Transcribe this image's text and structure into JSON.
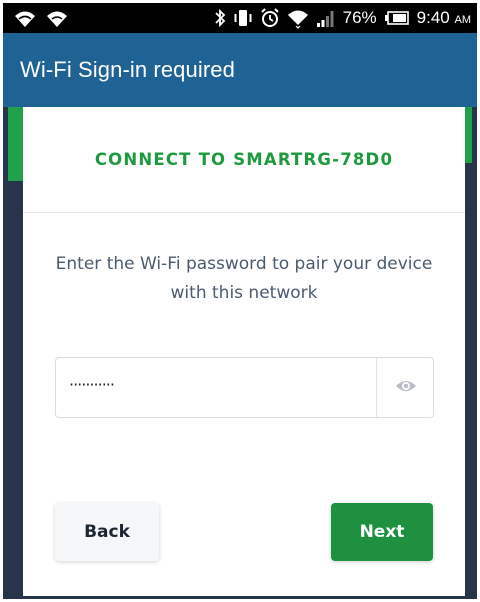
{
  "status_bar": {
    "battery_percent": "76%",
    "time": "9:40",
    "ampm": "AM",
    "icons": [
      "wifi-call-icon",
      "wifi-icon",
      "bluetooth-icon",
      "vibrate-icon",
      "alarm-icon",
      "wifi-icon",
      "signal-icon",
      "battery-icon"
    ]
  },
  "app_bar": {
    "title": "Wi-Fi Sign-in required"
  },
  "card": {
    "title": "CONNECT TO SMARTRG-78D0",
    "instruction": "Enter the Wi-Fi password to pair your device with this network",
    "password": {
      "masked_value": "···········",
      "toggle_icon": "eye-icon"
    },
    "buttons": {
      "back": "Back",
      "next": "Next"
    }
  },
  "colors": {
    "app_bar": "#1f6294",
    "accent_green": "#1e9a3e",
    "background": "#263549",
    "text_secondary": "#4a5b6d"
  }
}
